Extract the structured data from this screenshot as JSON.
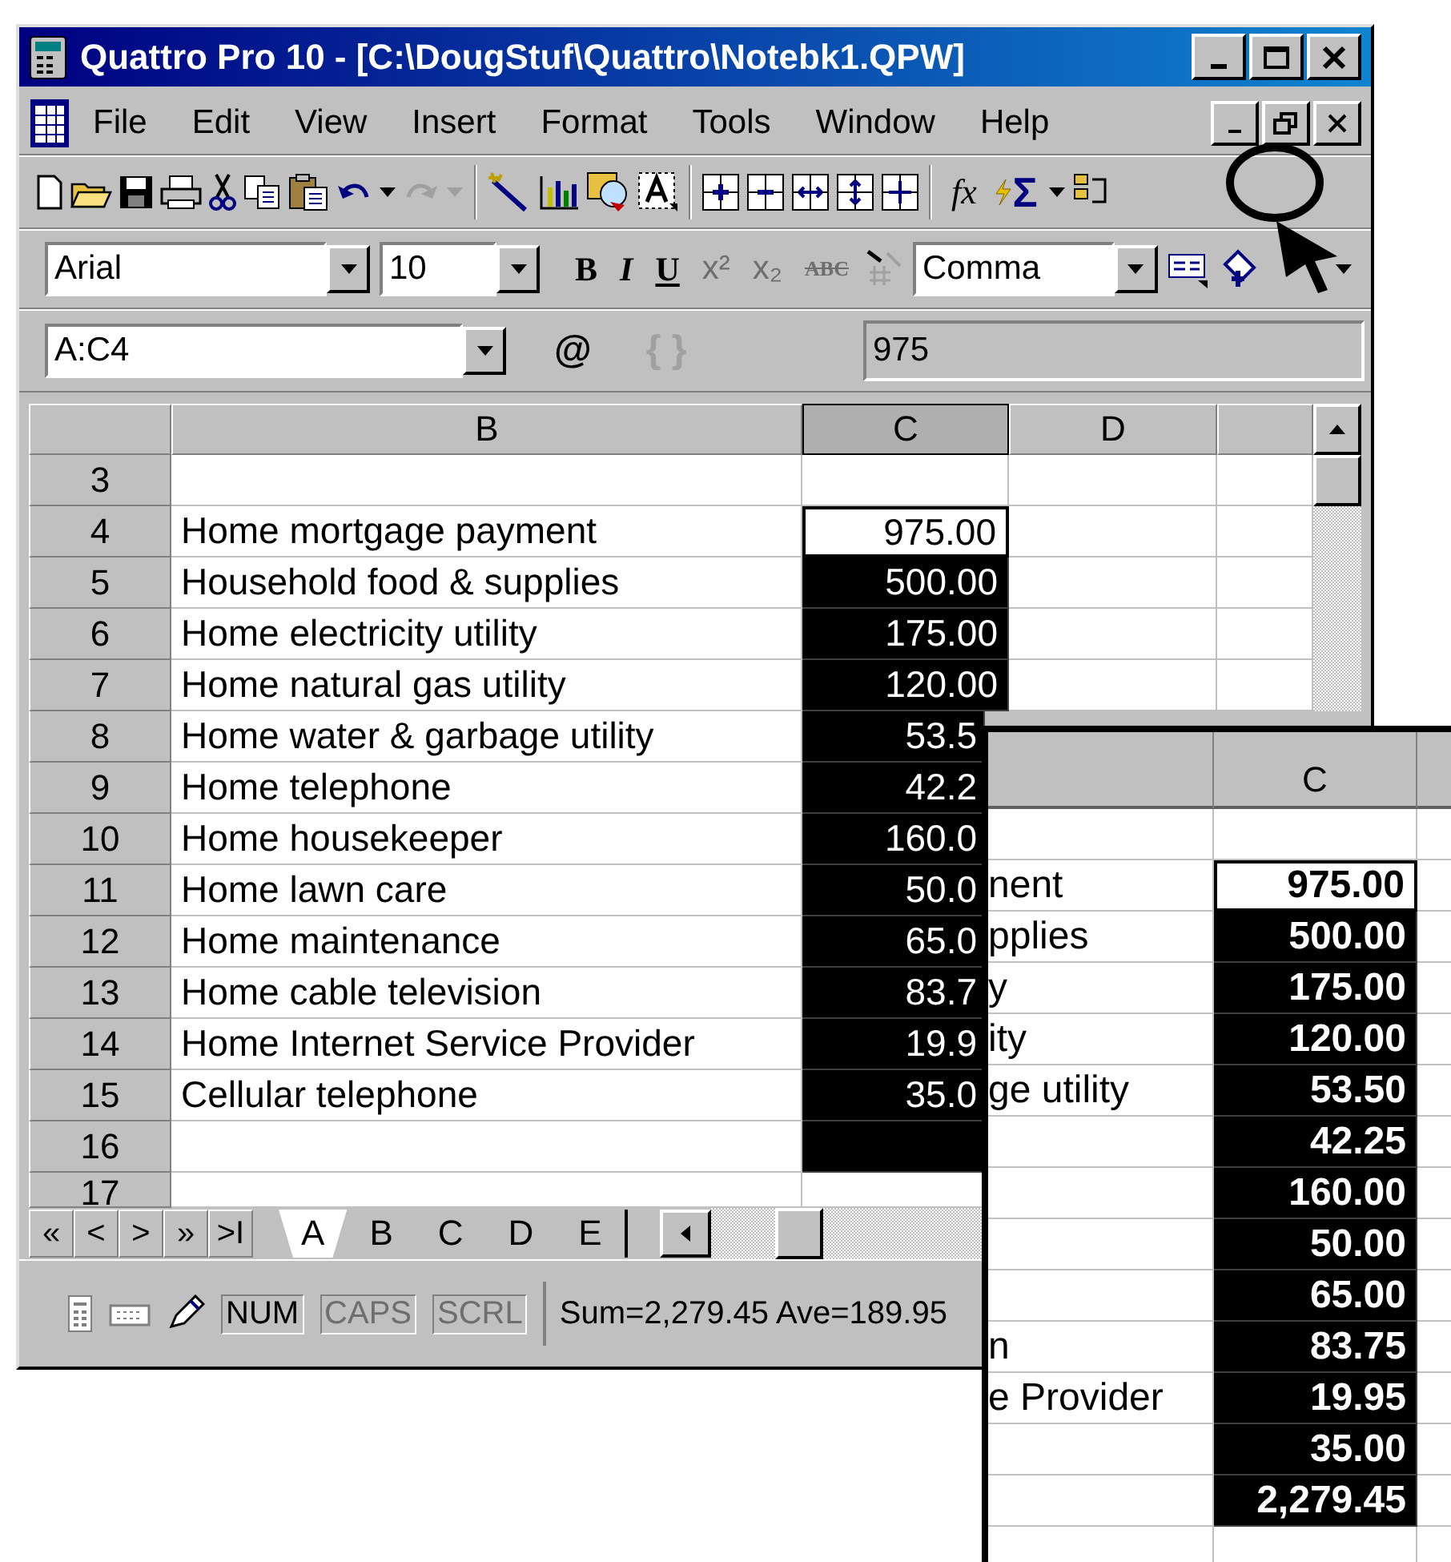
{
  "window": {
    "title": "Quattro Pro 10 - [C:\\DougStuf\\Quattro\\Notebk1.QPW]"
  },
  "menu": {
    "items": [
      "File",
      "Edit",
      "View",
      "Insert",
      "Format",
      "Tools",
      "Window",
      "Help"
    ]
  },
  "toolbar": {
    "function_label": "fx",
    "sum_label": "Σ"
  },
  "format_bar": {
    "font": "Arial",
    "size": "10",
    "style": "Comma",
    "buttons": [
      {
        "kind": "bold",
        "label": "B",
        "disabled": false
      },
      {
        "kind": "italic",
        "label": "I",
        "disabled": false
      },
      {
        "kind": "underline",
        "label": "U",
        "disabled": false
      },
      {
        "kind": "superscript",
        "label": "x²",
        "disabled": true
      },
      {
        "kind": "subscript",
        "label": "x₂",
        "disabled": true
      },
      {
        "kind": "strike",
        "label": "ABC",
        "disabled": true
      }
    ]
  },
  "input_line": {
    "cell": "A:C4",
    "at": {
      "label": "@",
      "disabled": false
    },
    "braces": {
      "label": "{ }",
      "disabled": true
    },
    "value": "975"
  },
  "sheet": {
    "columns": [
      {
        "label": "B",
        "selected": false
      },
      {
        "label": "C",
        "selected": true
      },
      {
        "label": "D",
        "selected": false
      }
    ],
    "rows": [
      {
        "num": "3",
        "label": "",
        "value": "",
        "selected": false,
        "current": false
      },
      {
        "num": "4",
        "label": "Home mortgage payment",
        "value": "975.00",
        "selected": false,
        "current": true
      },
      {
        "num": "5",
        "label": "Household food & supplies",
        "value": "500.00",
        "selected": true,
        "current": false
      },
      {
        "num": "6",
        "label": "Home electricity utility",
        "value": "175.00",
        "selected": true,
        "current": false
      },
      {
        "num": "7",
        "label": "Home natural gas utility",
        "value": "120.00",
        "selected": true,
        "current": false
      },
      {
        "num": "8",
        "label": "Home water & garbage utility",
        "value": "53.5",
        "selected": true,
        "current": false
      },
      {
        "num": "9",
        "label": "Home telephone",
        "value": "42.2",
        "selected": true,
        "current": false
      },
      {
        "num": "10",
        "label": "Home housekeeper",
        "value": "160.0",
        "selected": true,
        "current": false
      },
      {
        "num": "11",
        "label": "Home lawn care",
        "value": "50.0",
        "selected": true,
        "current": false
      },
      {
        "num": "12",
        "label": "Home maintenance",
        "value": "65.0",
        "selected": true,
        "current": false
      },
      {
        "num": "13",
        "label": "Home cable television",
        "value": "83.7",
        "selected": true,
        "current": false
      },
      {
        "num": "14",
        "label": "Home Internet Service Provider",
        "value": "19.9",
        "selected": true,
        "current": false
      },
      {
        "num": "15",
        "label": "Cellular telephone",
        "value": "35.0",
        "selected": true,
        "current": false
      },
      {
        "num": "16",
        "label": "",
        "value": "",
        "selected": true,
        "current": false
      },
      {
        "num": "17",
        "label": "",
        "value": "",
        "selected": false,
        "current": false
      }
    ]
  },
  "sheet_tabs": [
    {
      "label": "A",
      "selected": true
    },
    {
      "label": "B",
      "selected": false
    },
    {
      "label": "C",
      "selected": false
    },
    {
      "label": "D",
      "selected": false
    },
    {
      "label": "E",
      "selected": false
    }
  ],
  "tab_nav": [
    "«",
    "<",
    ">",
    "»",
    ">I"
  ],
  "status_bar": {
    "indicators": [
      {
        "label": "NUM",
        "on": true
      },
      {
        "label": "CAPS",
        "on": false
      },
      {
        "label": "SCRL",
        "on": false
      }
    ],
    "summary": "Sum=2,279.45  Ave=189.95"
  },
  "inset": {
    "column": "C",
    "rows": [
      {
        "label": "",
        "value": "",
        "selected": false,
        "current": false
      },
      {
        "label": "nent",
        "value": "975.00",
        "selected": false,
        "current": true
      },
      {
        "label": "pplies",
        "value": "500.00",
        "selected": true,
        "current": false
      },
      {
        "label": "y",
        "value": "175.00",
        "selected": true,
        "current": false
      },
      {
        "label": "ity",
        "value": "120.00",
        "selected": true,
        "current": false
      },
      {
        "label": "ge utility",
        "value": "53.50",
        "selected": true,
        "current": false
      },
      {
        "label": "",
        "value": "42.25",
        "selected": true,
        "current": false
      },
      {
        "label": "",
        "value": "160.00",
        "selected": true,
        "current": false
      },
      {
        "label": "",
        "value": "50.00",
        "selected": true,
        "current": false
      },
      {
        "label": "",
        "value": "65.00",
        "selected": true,
        "current": false
      },
      {
        "label": "n",
        "value": "83.75",
        "selected": true,
        "current": false
      },
      {
        "label": "e Provider",
        "value": "19.95",
        "selected": true,
        "current": false
      },
      {
        "label": "",
        "value": "35.00",
        "selected": true,
        "current": false
      },
      {
        "label": "",
        "value": "2,279.45",
        "selected": true,
        "current": false
      },
      {
        "label": "",
        "value": "",
        "selected": false,
        "current": false
      }
    ]
  }
}
